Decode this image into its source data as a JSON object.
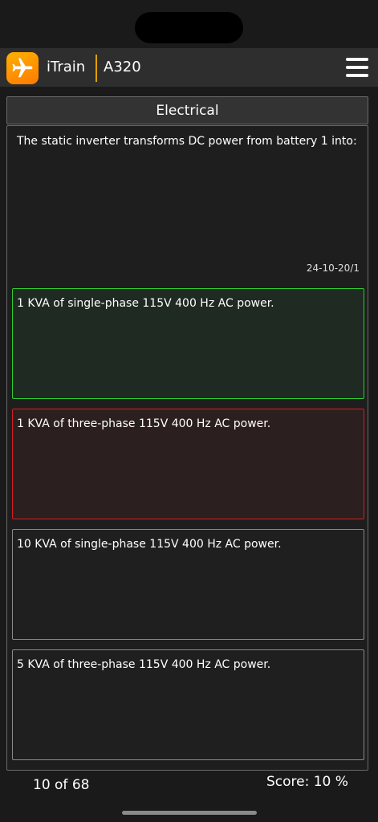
{
  "header": {
    "app_name": "iTrain",
    "aircraft": "A320",
    "app_icon": "airplane-icon",
    "menu_icon": "hamburger-menu-icon",
    "accent_color": "#e3a000"
  },
  "category": "Electrical",
  "question": {
    "text": "The static inverter transforms DC power from battery 1 into:",
    "reference": "24-10-20/1"
  },
  "answers": [
    {
      "text": "1 KVA of single-phase 115V 400 Hz AC power.",
      "state": "correct"
    },
    {
      "text": "1 KVA of three-phase 115V  400 Hz AC power.",
      "state": "wrong"
    },
    {
      "text": "10 KVA of single-phase 115V 400 Hz AC power.",
      "state": "neutral"
    },
    {
      "text": "5 KVA of three-phase 115V  400 Hz AC power.",
      "state": "neutral"
    }
  ],
  "footer": {
    "progress": "10 of 68",
    "score": "Score: 10 %"
  },
  "colors": {
    "correct": "#2ecc2e",
    "wrong": "#d42020"
  }
}
